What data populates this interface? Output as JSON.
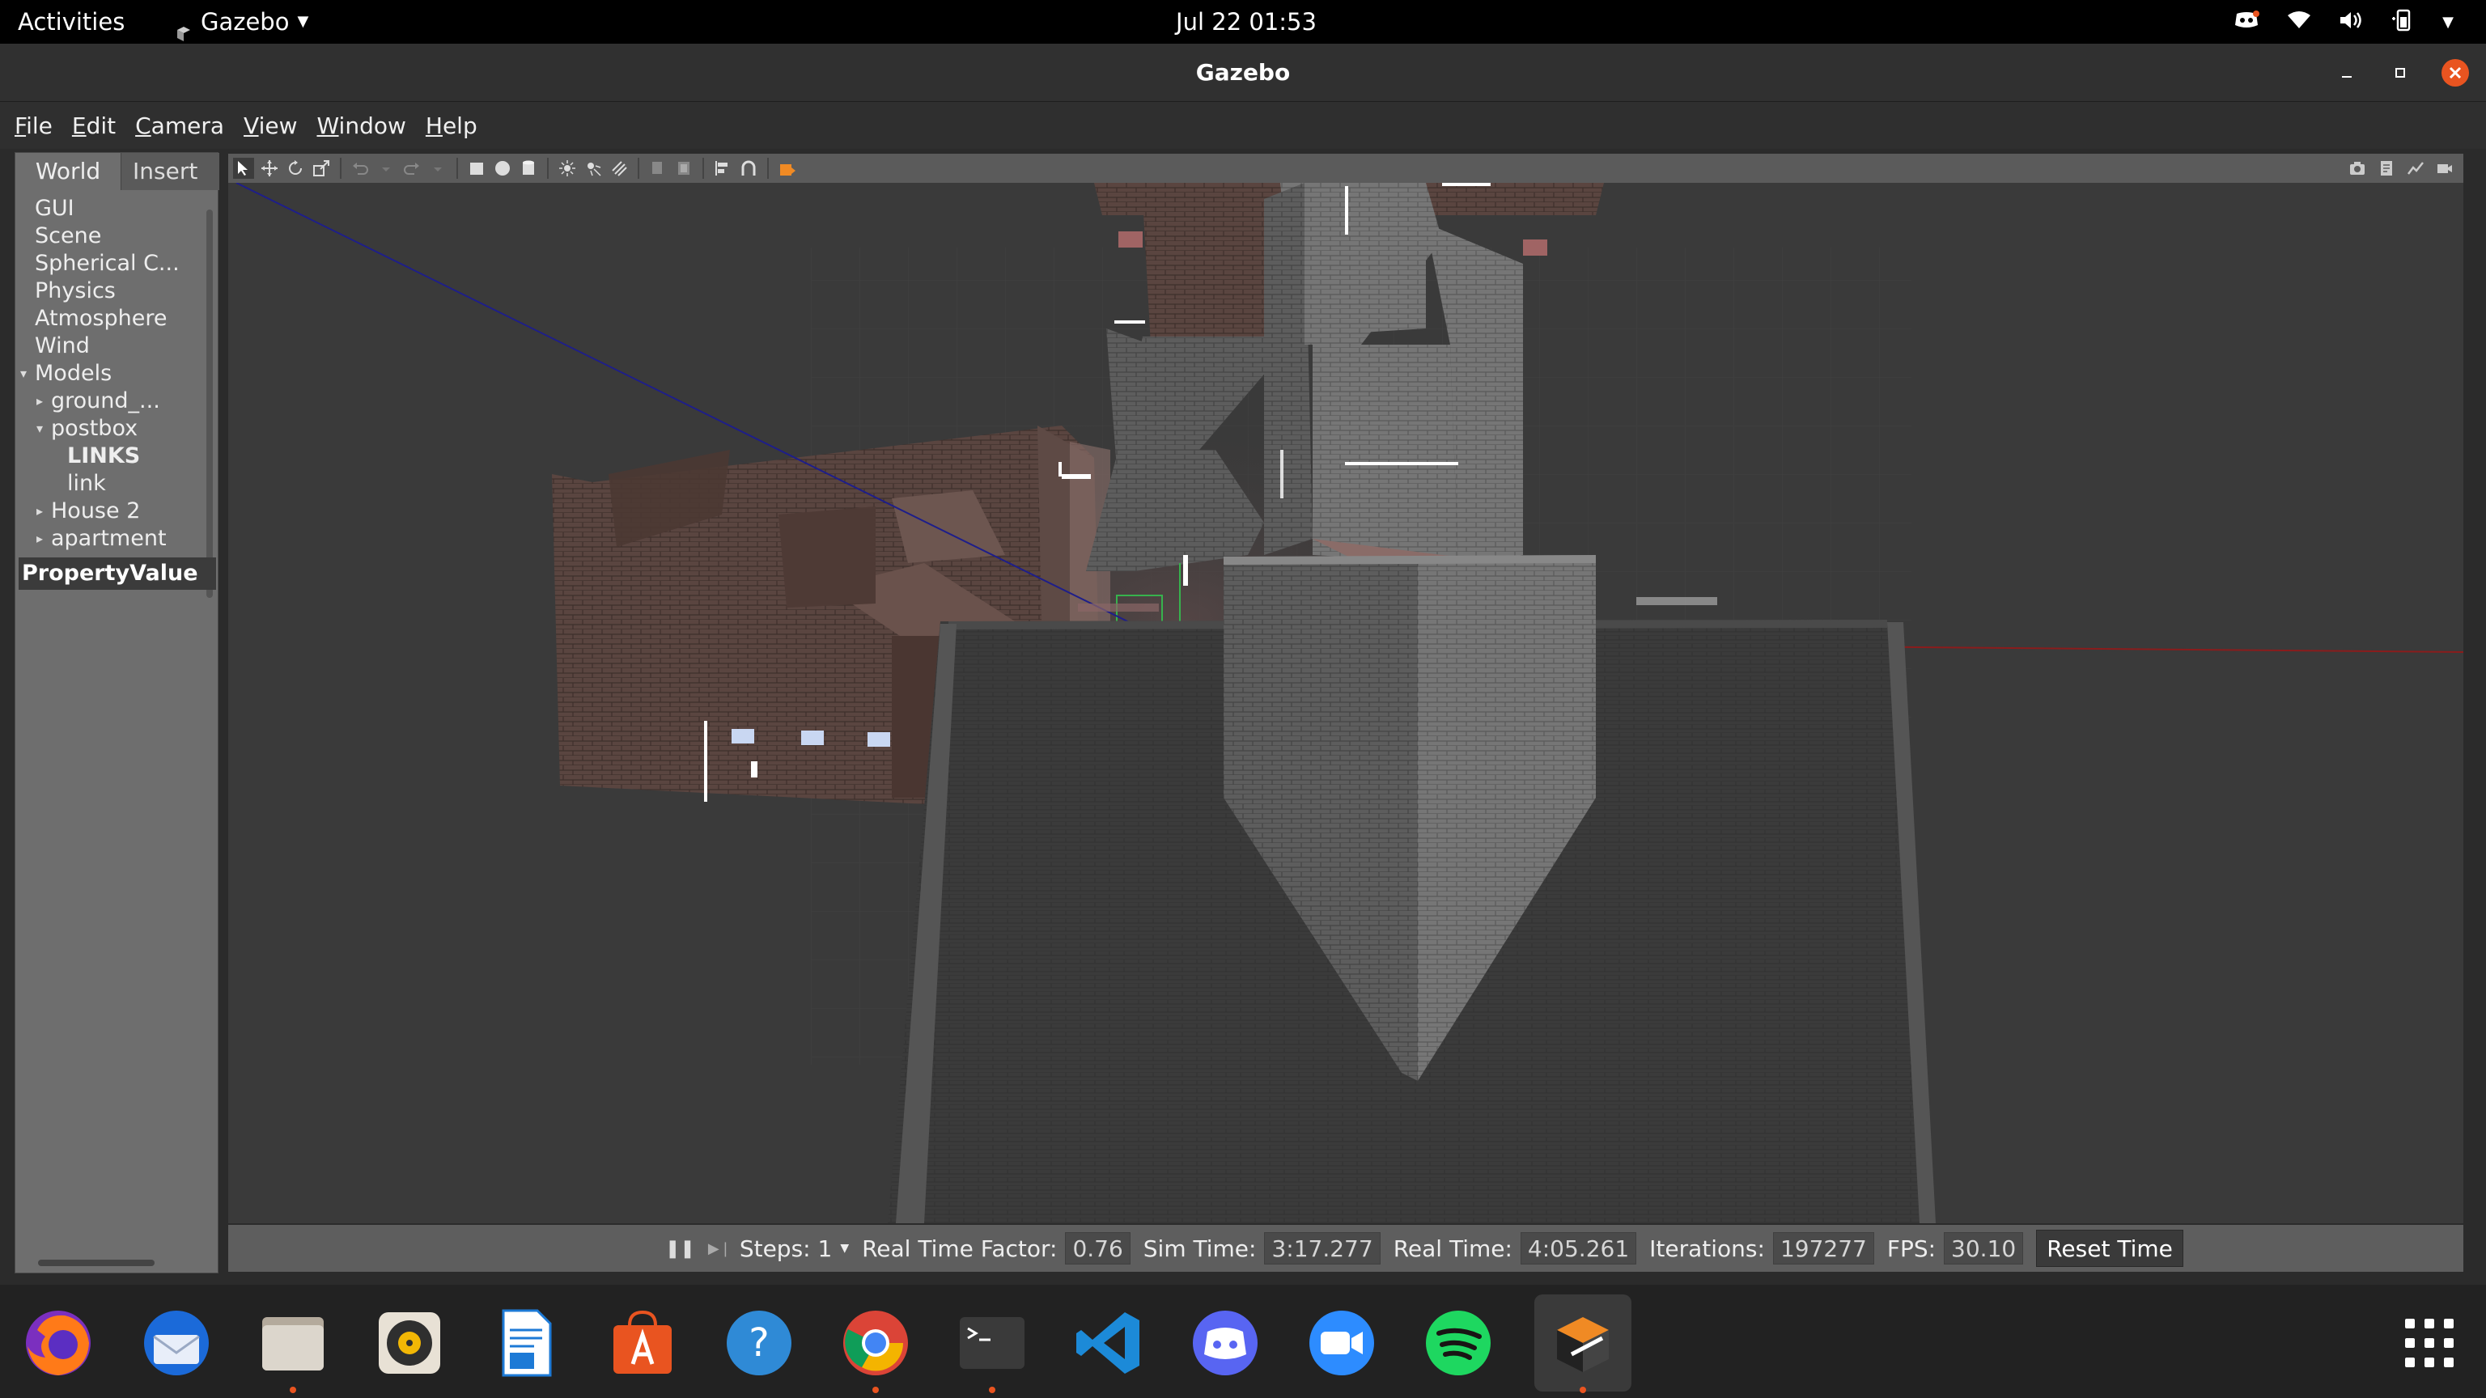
{
  "topbar": {
    "activities": "Activities",
    "app_name": "Gazebo",
    "datetime": "Jul 22  01:53"
  },
  "window": {
    "title": "Gazebo"
  },
  "menu": {
    "items": [
      "File",
      "Edit",
      "Camera",
      "View",
      "Window",
      "Help"
    ]
  },
  "left_panel": {
    "tabs": [
      "World",
      "Insert"
    ],
    "tree": [
      {
        "label": "GUI",
        "indent": 0,
        "arrow": ""
      },
      {
        "label": "Scene",
        "indent": 0,
        "arrow": ""
      },
      {
        "label": "Spherical C...",
        "indent": 0,
        "arrow": ""
      },
      {
        "label": "Physics",
        "indent": 0,
        "arrow": ""
      },
      {
        "label": "Atmosphere",
        "indent": 0,
        "arrow": ""
      },
      {
        "label": "Wind",
        "indent": 0,
        "arrow": ""
      },
      {
        "label": "Models",
        "indent": 0,
        "arrow": "down"
      },
      {
        "label": "ground_...",
        "indent": 1,
        "arrow": "right"
      },
      {
        "label": "postbox",
        "indent": 1,
        "arrow": "down"
      },
      {
        "label": "LINKS",
        "indent": 2,
        "arrow": "",
        "bold": true
      },
      {
        "label": "link",
        "indent": 2,
        "arrow": ""
      },
      {
        "label": "House 2",
        "indent": 1,
        "arrow": "right"
      },
      {
        "label": "apartment",
        "indent": 1,
        "arrow": "right"
      }
    ],
    "property_header": "PropertyValue"
  },
  "statusbar": {
    "steps_label": "Steps: 1",
    "rtf_label": "Real Time Factor:",
    "rtf_value": "0.76",
    "sim_time_label": "Sim Time:",
    "sim_time_value": "3:17.277",
    "real_time_label": "Real Time:",
    "real_time_value": "4:05.261",
    "iterations_label": "Iterations:",
    "iterations_value": "197277",
    "fps_label": "FPS:",
    "fps_value": "30.10",
    "reset_label": "Reset Time"
  },
  "dock": {
    "apps": [
      "firefox-icon",
      "thunderbird-icon",
      "files-icon",
      "rhythmbox-icon",
      "libreoffice-writer-icon",
      "software-center-icon",
      "help-icon",
      "chrome-icon",
      "terminal-icon",
      "vscode-icon",
      "discord-icon",
      "zoom-icon",
      "spotify-icon",
      "gazebo-icon",
      "app-grid-icon"
    ]
  },
  "colors": {
    "topbar_bg": "#000000",
    "ubuntu_orange": "#e95420",
    "viewport_bg": "#3a3a3a"
  }
}
